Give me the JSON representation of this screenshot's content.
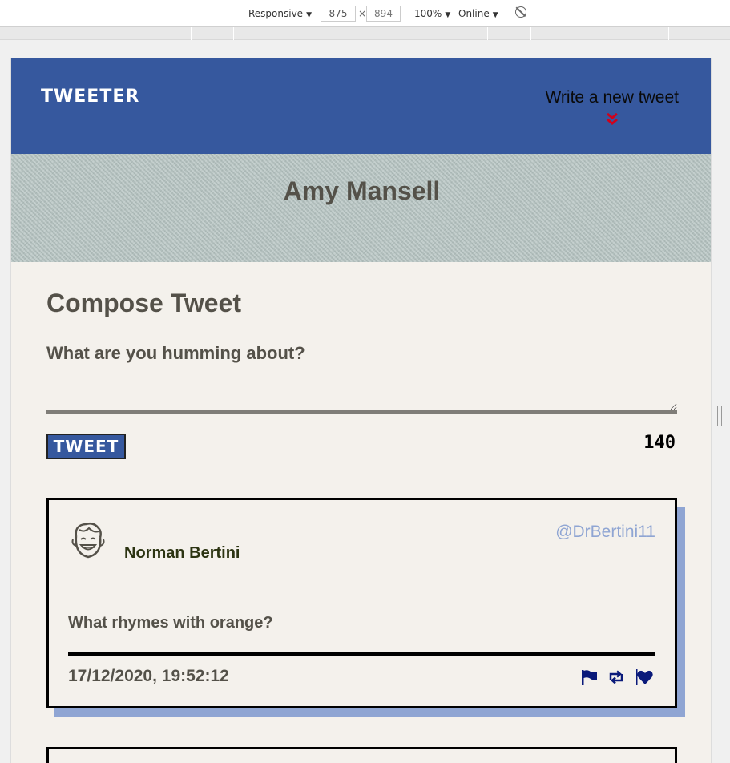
{
  "devtools": {
    "device": "Responsive",
    "width": "875",
    "times": "×",
    "height": "894",
    "zoom": "100%",
    "network": "Online"
  },
  "nav": {
    "brand": "TWEETER",
    "write_link": "Write a new tweet",
    "chevron_icon": "double-chevron-down-icon",
    "chevron_color": "#d0021b",
    "background": "#36589e"
  },
  "profile": {
    "name": "Amy Mansell"
  },
  "compose": {
    "title": "Compose Tweet",
    "prompt": "What are you humming about?",
    "input_value": "",
    "button_label": "TWEET",
    "counter": "140"
  },
  "tweets": [
    {
      "avatar_icon": "smiling-face-avatar-icon",
      "author": "Norman Bertini",
      "handle": "@DrBertini11",
      "text": "What rhymes with orange?",
      "timestamp": "17/12/2020, 19:52:12",
      "actions": [
        "flag-icon",
        "retweet-icon",
        "heart-icon"
      ]
    }
  ],
  "colors": {
    "accent": "#36589e",
    "shadow": "#8fa5d3",
    "text": "#545149",
    "icon": "#0a1a7a"
  }
}
